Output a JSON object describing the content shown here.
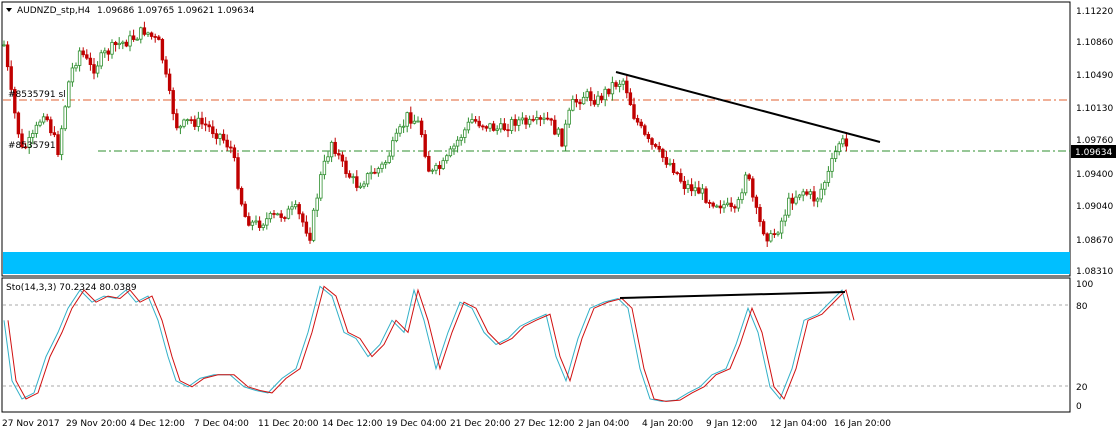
{
  "header": {
    "symbol_timeframe": "AUDNZD_stp,H4",
    "ohlc": "1.09686 1.09765 1.09621 1.09634"
  },
  "order_labels": {
    "sl_label": "#8535791 sl",
    "tp_label": "#8535791"
  },
  "indicator": {
    "label": "Sto(14,3,3) 70.2324 80.0389"
  },
  "colors": {
    "bull": "#2f8f2f",
    "bear": "#c00000",
    "zone": "#00bfff",
    "stoch_main": "#33b0c8",
    "stoch_signal": "#d01010",
    "sl_line": "#e06030",
    "entry_line": "#2f8f2f",
    "trendline": "#000000"
  },
  "price_scale": {
    "ticks": [
      "1.11220",
      "1.10860",
      "1.10490",
      "1.10130",
      "1.09760",
      "1.09400",
      "1.09040",
      "1.08670",
      "1.08310"
    ],
    "current": "1.09634"
  },
  "stoch_scale": {
    "ticks": [
      "100",
      "80",
      "20",
      "0"
    ]
  },
  "time_axis": {
    "labels": [
      "27 Nov 2017",
      "29 Nov 20:00",
      "4 Dec 12:00",
      "7 Dec 04:00",
      "11 Dec 20:00",
      "14 Dec 12:00",
      "19 Dec 04:00",
      "21 Dec 20:00",
      "27 Dec 12:00",
      "2 Jan 04:00",
      "4 Jan 20:00",
      "9 Jan 12:00",
      "12 Jan 04:00",
      "16 Jan 20:00"
    ]
  },
  "chart_data": {
    "type": "candlestick",
    "symbol": "AUDNZD_stp",
    "timeframe": "H4",
    "last_close": 1.09634,
    "sl_level": 1.1022,
    "entry_level": 1.0963,
    "demand_zone": [
      1.0829,
      1.0852
    ],
    "price_range": [
      1.0828,
      1.1127
    ],
    "stochastic": {
      "params": "14,3,3",
      "main": 70.2324,
      "signal": 80.0389,
      "levels": [
        20,
        80
      ],
      "range": [
        0,
        100
      ]
    }
  }
}
